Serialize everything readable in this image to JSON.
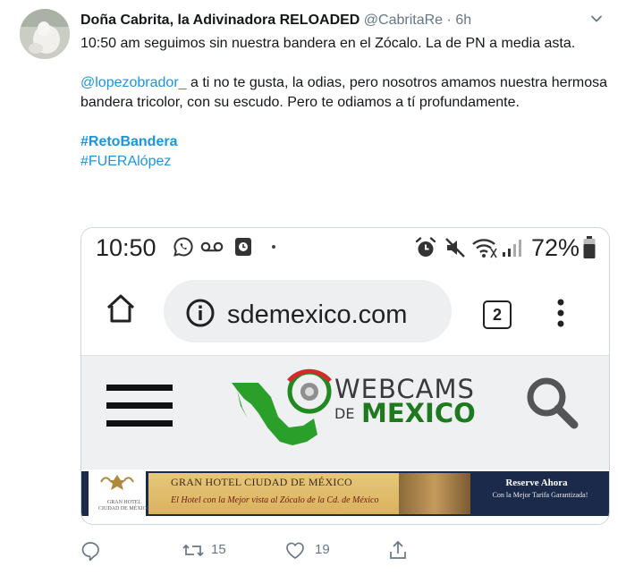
{
  "tweet": {
    "author_name": "Doña Cabrita, la Adivinadora RELOADED",
    "author_handle": "@CabritaRe",
    "separator": "·",
    "time_ago": "6h",
    "text_line1": "10:50 am seguimos sin nuestra bandera en el Zócalo.  La de PN a media asta.",
    "mention": "@lopezobrador_",
    "text_line2": "  a ti no te gusta, la odias,  pero nosotros amamos nuestra hermosa bandera tricolor, con su escudo. Pero te odiamos a tí profundamente.",
    "hashtag1": "#RetoBandera",
    "hashtag2": "#FUERAlópez"
  },
  "screenshot": {
    "clock": "10:50",
    "battery_percent": "72%",
    "url": "sdemexico.com",
    "tab_count": "2",
    "brand_line1": "WEBCAMS",
    "brand_de": "DE",
    "brand_line2": "MEXICO",
    "ad": {
      "logo_text": "GRAN HOTEL CIUDAD DE MÉXICO",
      "title": "GRAN HOTEL CIUDAD DE MÉXICO",
      "subtitle": "El Hotel con la Mejor vista al Zócalo de la Cd. de México",
      "cta": "Reserve Ahora",
      "cta_sub": "Con la Mejor Tarifa Garantizada!"
    }
  },
  "actions": {
    "retweets": "15",
    "likes": "19"
  },
  "colors": {
    "link": "#1b95e0",
    "muted": "#657786",
    "brand_green": "#1f7a1f"
  },
  "icons": [
    "caret-down-icon",
    "whatsapp-icon",
    "voicemail-icon",
    "alarm-icon",
    "mute-icon",
    "wifi-icon",
    "signal-icon",
    "battery-icon",
    "home-icon",
    "info-icon",
    "more-vert-icon",
    "hamburger-icon",
    "magnifier-icon",
    "reply-icon",
    "retweet-icon",
    "heart-icon",
    "share-icon"
  ]
}
